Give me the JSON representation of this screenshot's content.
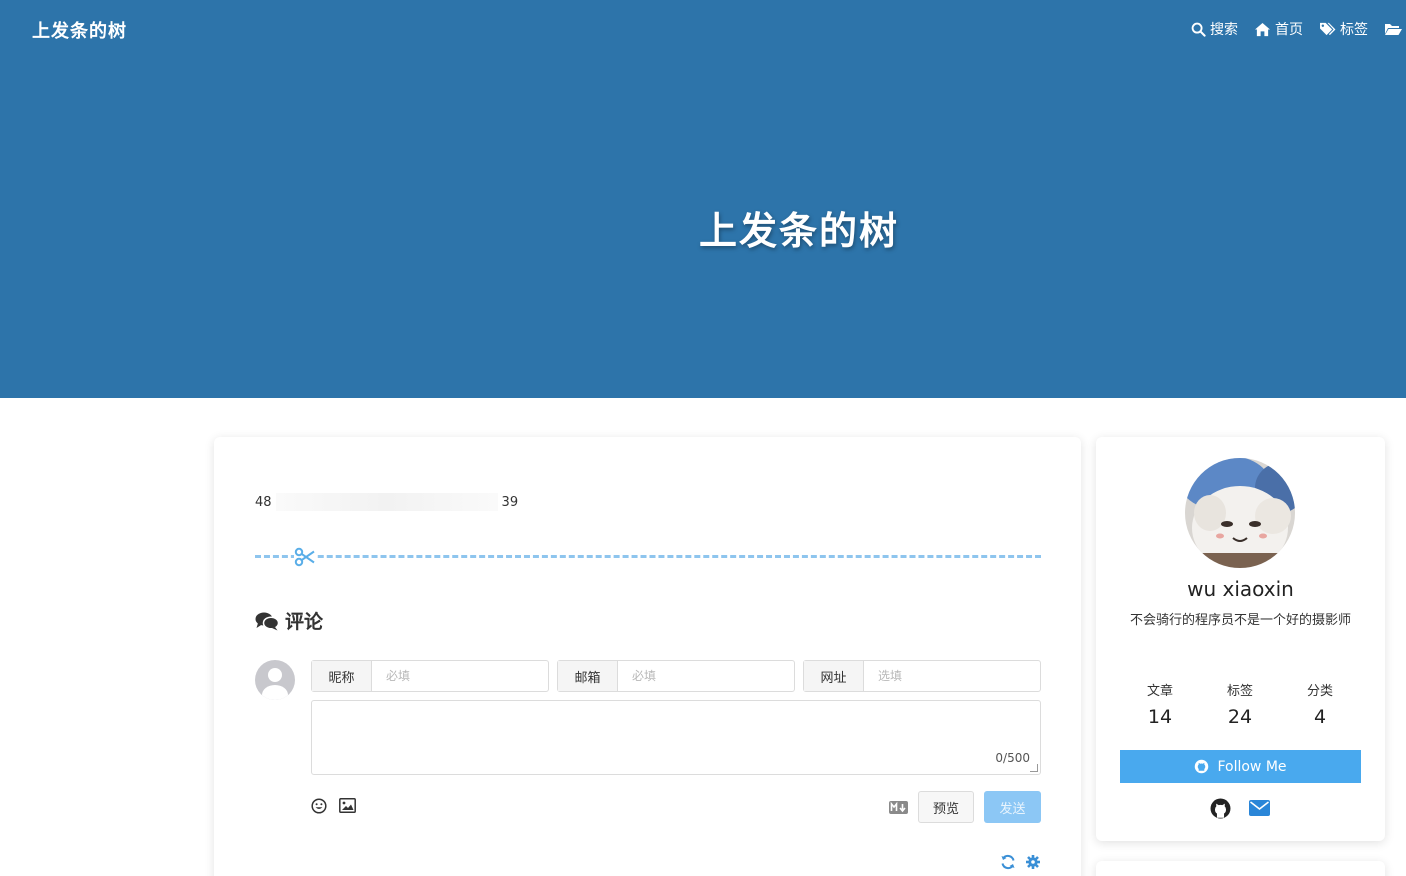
{
  "site": {
    "brand": "上发条的树",
    "hero_title": "上发条的树"
  },
  "nav": {
    "items": [
      {
        "label": "搜索",
        "icon": "search-icon"
      },
      {
        "label": "首页",
        "icon": "home-icon"
      },
      {
        "label": "标签",
        "icon": "tags-icon"
      },
      {
        "label": "",
        "icon": "folder-icon"
      }
    ]
  },
  "post": {
    "line_start": "48",
    "line_end": "39"
  },
  "comments": {
    "heading": "评论",
    "fields": {
      "nick_label": "昵称",
      "nick_placeholder": "必填",
      "mail_label": "邮箱",
      "mail_placeholder": "必填",
      "link_label": "网址",
      "link_placeholder": "选填"
    },
    "counter": "0/500",
    "preview_label": "预览",
    "send_label": "发送"
  },
  "sidebar": {
    "author_name": "wu xiaoxin",
    "bio": "不会骑行的程序员不是一个好的摄影师",
    "stats": [
      {
        "label": "文章",
        "value": "14"
      },
      {
        "label": "标签",
        "value": "24"
      },
      {
        "label": "分类",
        "value": "4"
      }
    ],
    "follow_label": "Follow Me"
  },
  "colors": {
    "hero_bg": "#2d74aa",
    "accent": "#49a9ee",
    "divider": "#8ec5ee",
    "send_disabled": "#8cc7f5"
  }
}
